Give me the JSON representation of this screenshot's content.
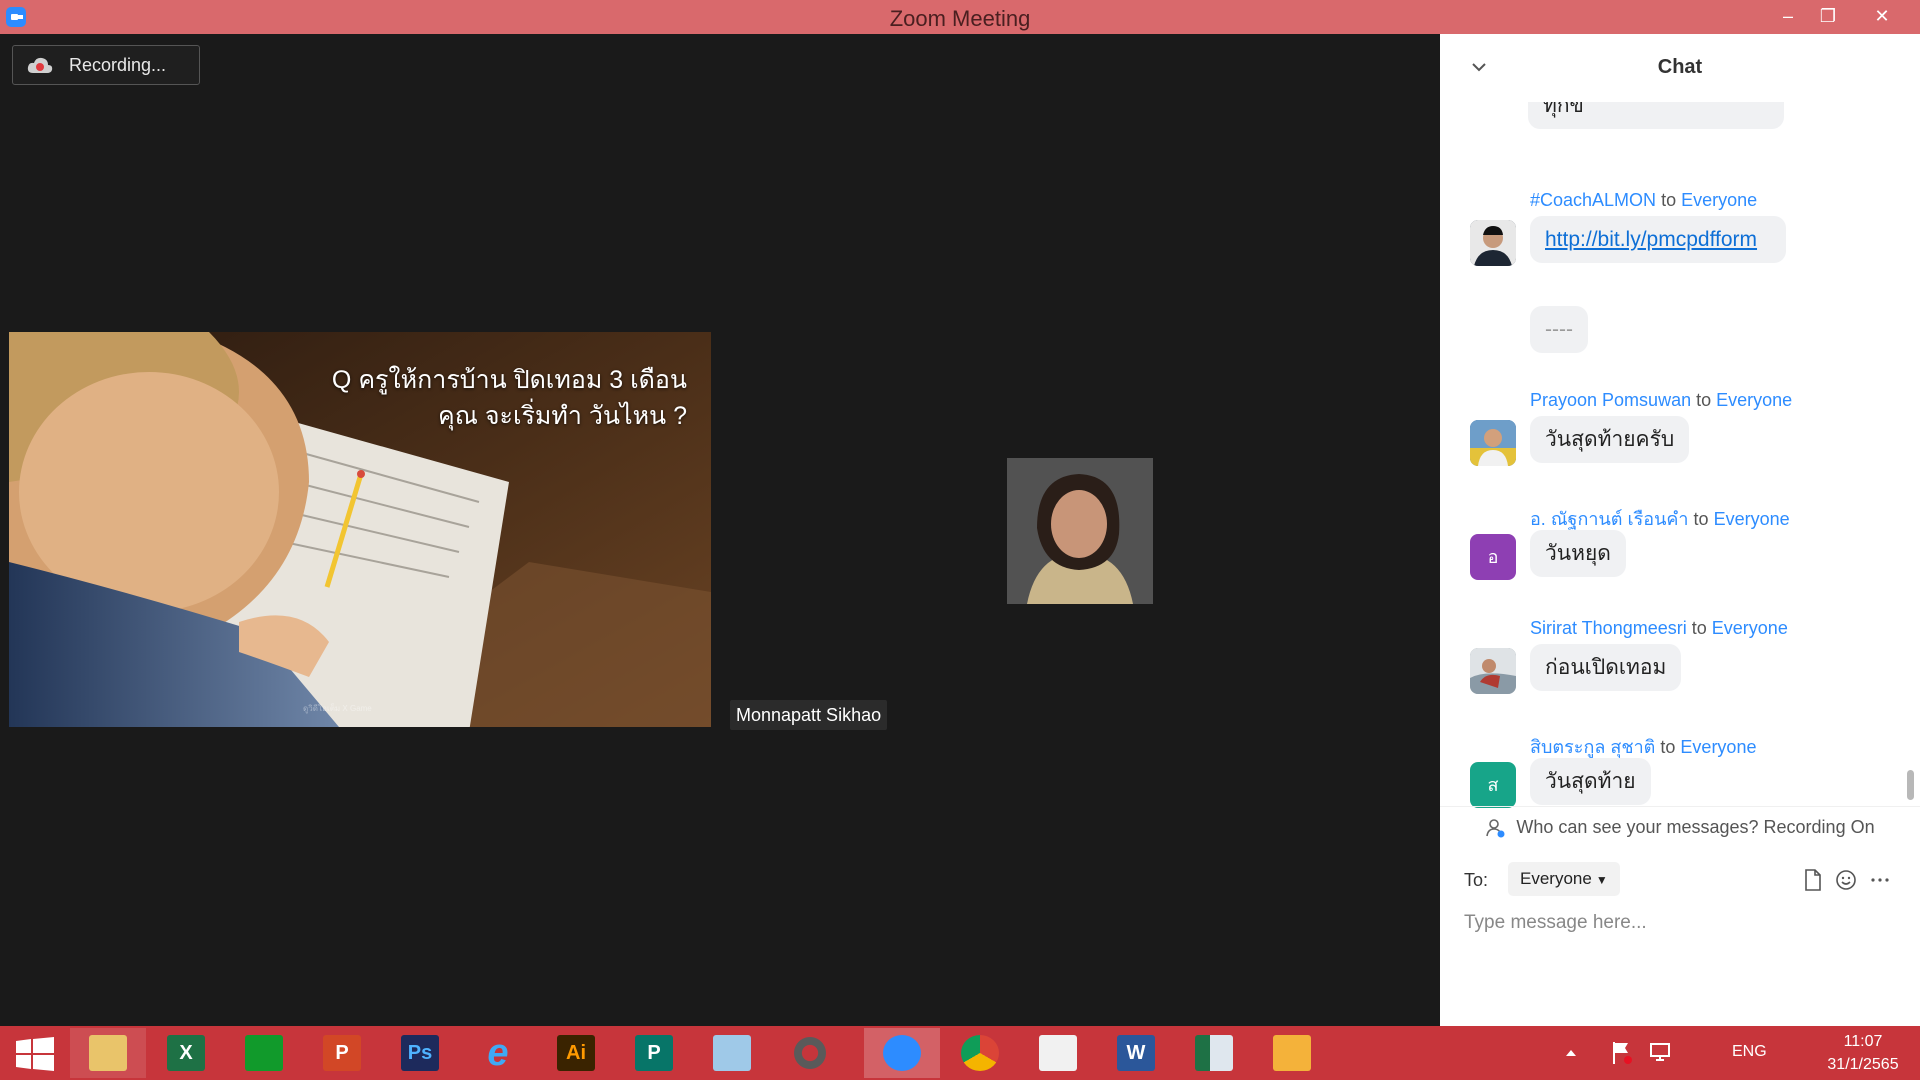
{
  "window": {
    "title": "Zoom Meeting",
    "minimize": "–",
    "restore": "❐",
    "close": "✕"
  },
  "meeting": {
    "recording_label": "Recording...",
    "slide_line1": "Q ครูให้การบ้าน ปิดเทอม 3 เดือน",
    "slide_line2": "คุณ จะเริ่มทำ วันไหน ?",
    "slide_watermark": "ดูวิดีโอเต็ม X Game",
    "participant_name": "Monnapatt Sikhao"
  },
  "chat": {
    "title": "Chat",
    "partial_top_message": "ทุกข์",
    "messages": [
      {
        "sender": "#CoachALMON",
        "to": "to",
        "recipient": "Everyone",
        "text": "http://bit.ly/pmcpdfform",
        "text2": "----",
        "avatar_type": "photo",
        "avatar_color": "#2c3e50"
      },
      {
        "sender": "Prayoon Pomsuwan",
        "to": "to",
        "recipient": "Everyone",
        "text": "วันสุดท้ายครับ",
        "avatar_type": "photo",
        "avatar_color": "#3b6ea5"
      },
      {
        "sender": "อ. ณัฐกานต์  เรือนคำ",
        "to": "to",
        "recipient": "Everyone",
        "text": "วันหยุด",
        "avatar_type": "initial",
        "avatar_initial": "อ",
        "avatar_color": "#8e3fb3"
      },
      {
        "sender": "Sirirat Thongmeesri",
        "to": "to",
        "recipient": "Everyone",
        "text": "ก่อนเปิดเทอม",
        "avatar_type": "photo",
        "avatar_color": "#7c8a96"
      },
      {
        "sender": "สิบตระกูล สุชาติ",
        "to": "to",
        "recipient": "Everyone",
        "text": "วันสุดท้าย",
        "avatar_type": "initial",
        "avatar_initial": "ส",
        "avatar_color": "#17a589"
      }
    ],
    "notice": "Who can see your messages? Recording On",
    "to_label": "To:",
    "recipient_select": "Everyone",
    "composer_placeholder": "Type message here..."
  },
  "taskbar": {
    "apps": [
      {
        "name": "file-explorer",
        "label": ""
      },
      {
        "name": "excel",
        "label": "X"
      },
      {
        "name": "store",
        "label": ""
      },
      {
        "name": "powerpoint",
        "label": "P"
      },
      {
        "name": "photoshop",
        "label": "Ps"
      },
      {
        "name": "internet-explorer",
        "label": "e"
      },
      {
        "name": "illustrator",
        "label": "Ai"
      },
      {
        "name": "publisher",
        "label": "P"
      },
      {
        "name": "paint",
        "label": ""
      },
      {
        "name": "photoscape",
        "label": ""
      },
      {
        "name": "zoom",
        "label": ""
      },
      {
        "name": "chrome",
        "label": ""
      },
      {
        "name": "powerpoint-slideshow",
        "label": ""
      },
      {
        "name": "word",
        "label": "W"
      },
      {
        "name": "desktop-app",
        "label": ""
      },
      {
        "name": "photo-viewer",
        "label": ""
      }
    ],
    "language": "ENG",
    "time": "11:07",
    "date": "31/1/2565"
  },
  "colors": {
    "titlebar": "#d9696c",
    "taskbar": "#c7353b",
    "accent": "#2d8cff"
  }
}
